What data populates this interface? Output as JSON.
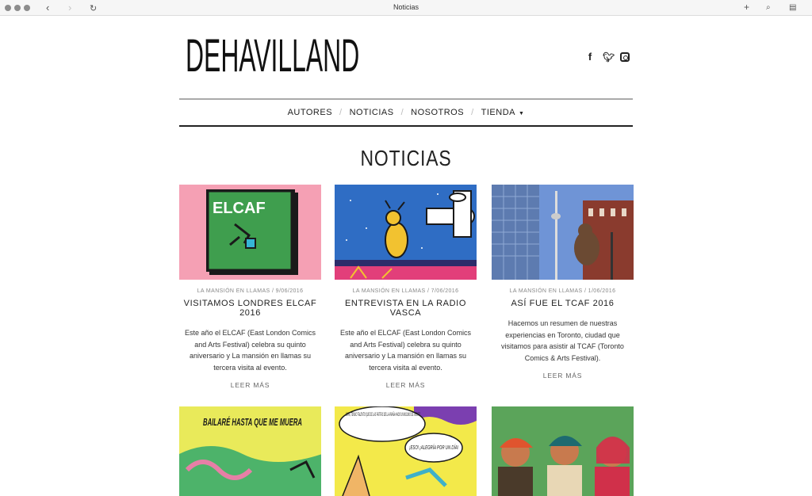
{
  "browser": {
    "title": "Noticias"
  },
  "site": {
    "logo": "DEHAVILLAND",
    "social": [
      "facebook-icon",
      "twitter-icon",
      "instagram-icon"
    ]
  },
  "menu": {
    "items": [
      "AUTORES",
      "NOTICIAS",
      "NOSOTROS",
      "TIENDA"
    ]
  },
  "page": {
    "title": "NOTICIAS"
  },
  "posts": [
    {
      "meta": "LA MANSIÓN EN LLAMAS / 9/06/2016",
      "title": "VISITAMOS LONDRES ELCAF 2016",
      "excerpt": "Este año el ELCAF (East London Comics and Arts Festival) celebra su quinto aniversario y La mansión en llamas su tercera visita al evento.",
      "more": "LEER MÁS",
      "image_text": "ELCAF"
    },
    {
      "meta": "LA MANSIÓN EN LLAMAS / 7/06/2016",
      "title": "ENTREVISTA EN LA RADIO VASCA",
      "excerpt": "Este año el ELCAF (East London Comics and Arts Festival) celebra su quinto aniversario y La mansión en llamas su tercera visita al evento.",
      "more": "LEER MÁS"
    },
    {
      "meta": "LA MANSIÓN EN LLAMAS / 1/06/2016",
      "title": "ASÍ FUE EL TCAF 2016",
      "excerpt": "Hacemos un resumen de nuestras experiencias en Toronto, ciudad que visitamos para asistir al TCAF (Toronto Comics & Arts Festival).",
      "more": "LEER MÁS"
    }
  ],
  "bottom_images": [
    {
      "text": "BAILARÉ HASTA QUE ME MUERA"
    },
    {
      "text1": "MIRA, TENGO TALENTO QUE DE LAS PATITAS DE LA ARAÑA HAGO UN MOLINO DE VIENTO",
      "text2": "¡ESO! ¡ALEGRÍA POR UN DÍA!"
    },
    {
      "text": ""
    }
  ]
}
